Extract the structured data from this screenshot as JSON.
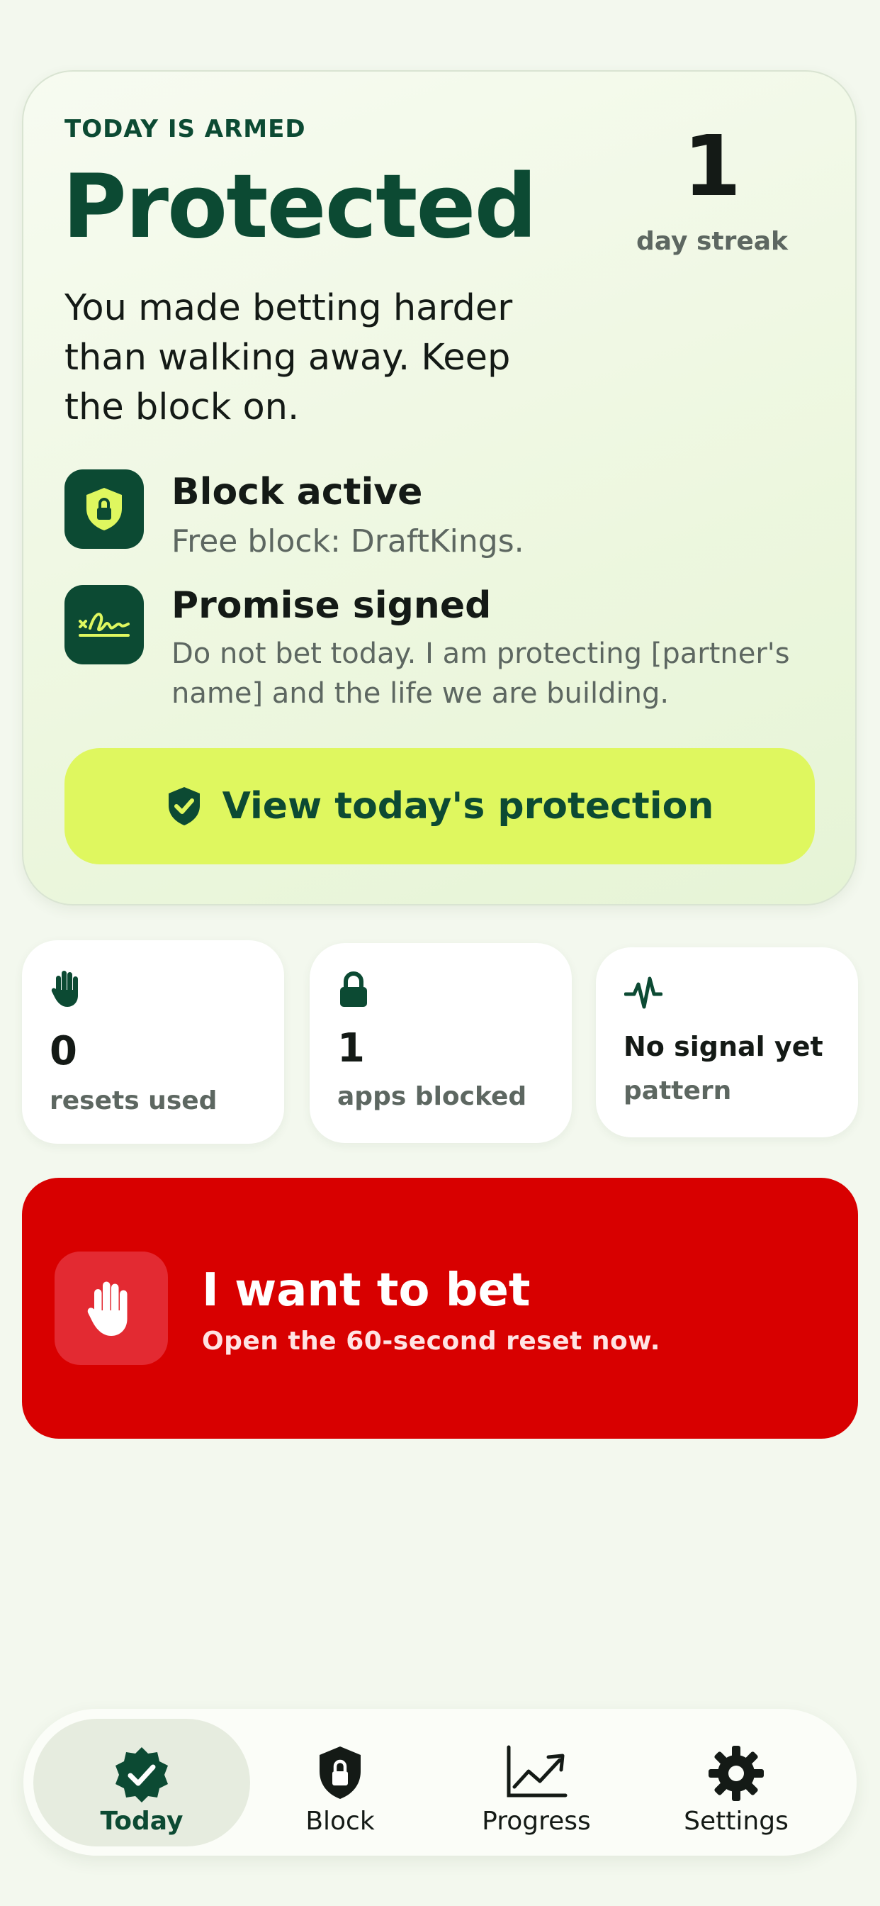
{
  "colors": {
    "brand_green": "#0c4a33",
    "lime_accent": "#dff75f",
    "danger_red": "#d80000",
    "background": "#f3f8ee"
  },
  "hero": {
    "eyebrow": "TODAY IS ARMED",
    "title": "Protected",
    "subtitle": "You made betting harder than walking away. Keep the block on.",
    "streak_value": "1",
    "streak_label": "day streak",
    "features": [
      {
        "icon": "shield-lock-icon",
        "title": "Block active",
        "subtitle": "Free block: DraftKings."
      },
      {
        "icon": "signature-icon",
        "title": "Promise signed",
        "subtitle": "Do not bet today. I am protecting [partner's name] and the life we are building."
      }
    ],
    "cta": {
      "icon": "shield-check-icon",
      "label": "View today's protection"
    }
  },
  "stats": [
    {
      "icon": "hand-icon",
      "value": "0",
      "label": "resets used"
    },
    {
      "icon": "lock-icon",
      "value": "1",
      "label": "apps blocked"
    },
    {
      "icon": "pulse-icon",
      "value": "No signal yet",
      "label": "pattern"
    }
  ],
  "bet_button": {
    "icon": "hand-stop-icon",
    "title": "I want to bet",
    "subtitle": "Open the 60-second reset now."
  },
  "tabbar": {
    "tabs": [
      {
        "icon": "verified-badge-icon",
        "label": "Today",
        "active": true
      },
      {
        "icon": "shield-lock-icon",
        "label": "Block",
        "active": false
      },
      {
        "icon": "trend-chart-icon",
        "label": "Progress",
        "active": false
      },
      {
        "icon": "gear-icon",
        "label": "Settings",
        "active": false
      }
    ]
  }
}
